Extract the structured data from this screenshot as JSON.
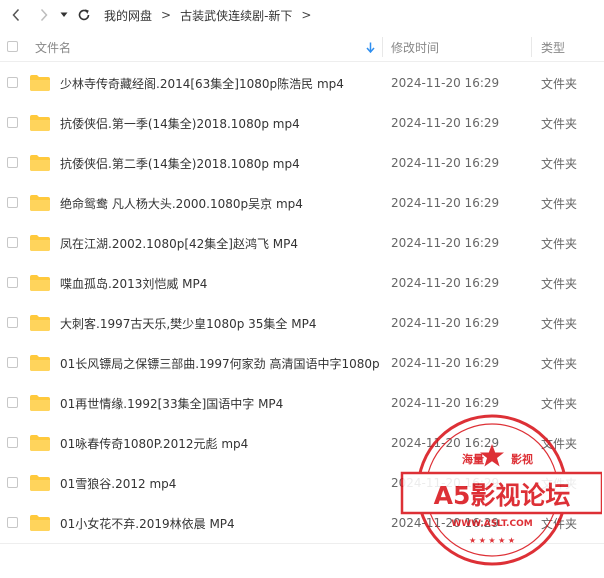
{
  "toolbar": {
    "breadcrumb": [
      "我的网盘",
      "古装武侠连续剧-新下"
    ]
  },
  "header": {
    "name": "文件名",
    "modified": "修改时间",
    "type": "类型"
  },
  "files": [
    {
      "name": "少林寺传奇藏经阁.2014[63集全]1080p陈浩民 mp4",
      "time": "2024-11-20 16:29",
      "type": "文件夹"
    },
    {
      "name": "抗倭侠侣.第一季(14集全)2018.1080p mp4",
      "time": "2024-11-20 16:29",
      "type": "文件夹"
    },
    {
      "name": "抗倭侠侣.第二季(14集全)2018.1080p mp4",
      "time": "2024-11-20 16:29",
      "type": "文件夹"
    },
    {
      "name": "绝命鸳鸯 凡人杨大头.2000.1080p吴京 mp4",
      "time": "2024-11-20 16:29",
      "type": "文件夹"
    },
    {
      "name": "凤在江湖.2002.1080p[42集全]赵鸿飞 MP4",
      "time": "2024-11-20 16:29",
      "type": "文件夹"
    },
    {
      "name": "喋血孤岛.2013刘恺威 MP4",
      "time": "2024-11-20 16:29",
      "type": "文件夹"
    },
    {
      "name": "大刺客.1997古天乐,樊少皇1080p 35集全 MP4",
      "time": "2024-11-20 16:29",
      "type": "文件夹"
    },
    {
      "name": "01长风镖局之保镖三部曲.1997何家劲 高清国语中字1080p",
      "time": "2024-11-20 16:29",
      "type": "文件夹"
    },
    {
      "name": "01再世情缘.1992[33集全]国语中字 MP4",
      "time": "2024-11-20 16:29",
      "type": "文件夹"
    },
    {
      "name": "01咏春传奇1080P.2012元彪 mp4",
      "time": "2024-11-20 16:29",
      "type": "文件夹"
    },
    {
      "name": "01雪狼谷.2012 mp4",
      "time": "2024-11-20 16:29",
      "type": "文件夹"
    },
    {
      "name": "01小女花不弃.2019林依晨 MP4",
      "time": "2024-11-20 16:29",
      "type": "文件夹"
    }
  ],
  "watermark": {
    "top_text": "海量",
    "top_text_right": "影视",
    "title": "A5影视论坛",
    "url": "WWW.A5LT.COM"
  },
  "colors": {
    "folder": "#ffc93c",
    "sort_arrow": "#2f8ff0",
    "seal": "#d9141b"
  }
}
